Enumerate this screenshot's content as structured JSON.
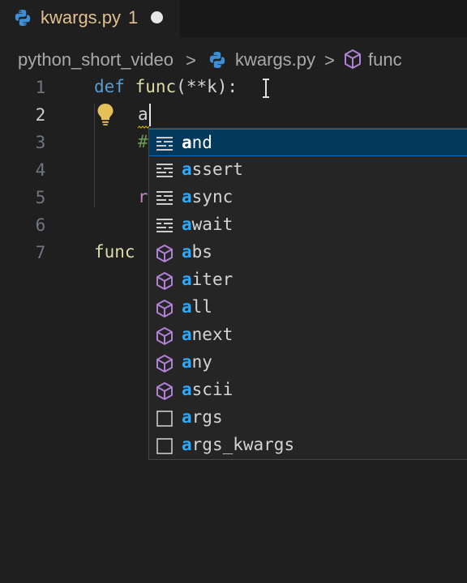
{
  "tab": {
    "title": "kwargs.py",
    "problem_count": "1",
    "icon": "python-icon"
  },
  "breadcrumb": {
    "folder": "python_short_video",
    "file": "kwargs.py",
    "symbol": "func",
    "separator": ">"
  },
  "gutter": {
    "lines": [
      "1",
      "2",
      "3",
      "4",
      "5",
      "6",
      "7"
    ],
    "active_line": "2"
  },
  "code": {
    "line1": {
      "keyword": "def",
      "name": "func",
      "params": "(**k):"
    },
    "line2": {
      "typed": "a"
    },
    "line3": {
      "comment_start": "#"
    },
    "line5": {
      "return_start": "r"
    },
    "line7": {
      "call": "func"
    }
  },
  "suggestions": [
    {
      "match": "a",
      "rest": "nd",
      "kind": "keyword",
      "selected": true
    },
    {
      "match": "a",
      "rest": "ssert",
      "kind": "keyword"
    },
    {
      "match": "a",
      "rest": "sync",
      "kind": "keyword"
    },
    {
      "match": "a",
      "rest": "wait",
      "kind": "keyword"
    },
    {
      "match": "a",
      "rest": "bs",
      "kind": "method"
    },
    {
      "match": "a",
      "rest": "iter",
      "kind": "method"
    },
    {
      "match": "a",
      "rest": "ll",
      "kind": "method"
    },
    {
      "match": "a",
      "rest": "next",
      "kind": "method"
    },
    {
      "match": "a",
      "rest": "ny",
      "kind": "method"
    },
    {
      "match": "a",
      "rest": "scii",
      "kind": "method"
    },
    {
      "match": "a",
      "rest": "rgs",
      "kind": "text"
    },
    {
      "match": "a",
      "rest": "rgs_kwargs",
      "kind": "text"
    }
  ],
  "colors": {
    "keyword": "#569cd6",
    "function": "#dcdcaa",
    "method_icon": "#b180d7",
    "highlight": "#2aaaff",
    "selection": "#04395e"
  }
}
